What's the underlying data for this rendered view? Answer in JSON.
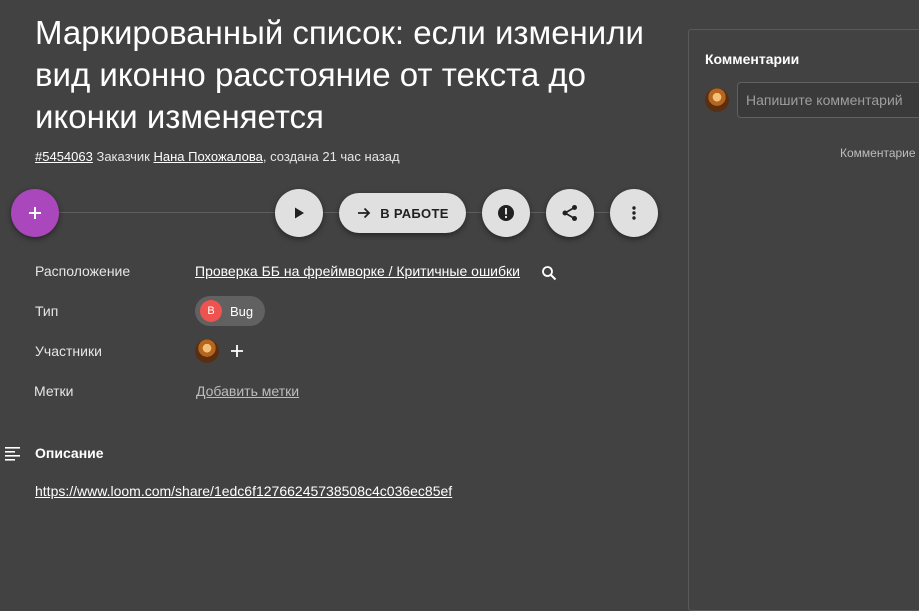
{
  "task": {
    "title": "Маркированный список: если изменили вид иконно расстояние от текста до иконки изменяется",
    "id": "#5454063",
    "customer_prefix": "Заказчик",
    "customer_name": "Нана Похожалова",
    "created": ", создана 21 час назад"
  },
  "actions": {
    "add_icon": "plus-icon",
    "play_icon": "play-icon",
    "status_label": "В РАБОТЕ",
    "status_icon": "arrow-right-icon",
    "priority_icon": "alert-icon",
    "share_icon": "share-icon",
    "more_icon": "more-vert-icon",
    "fab_color": "#ab47bc"
  },
  "fields": {
    "location_label": "Расположение",
    "location_value": "Проверка ББ на фреймворке / Критичные ошибки",
    "type_label": "Тип",
    "type_letter": "B",
    "type_value": "Bug",
    "type_color": "#ef5350",
    "participants_label": "Участники",
    "tags_label": "Метки",
    "tags_value": "Добавить метки"
  },
  "description": {
    "title": "Описание",
    "link": "https://www.loom.com/share/1edc6f12766245738508c4c036ec85ef"
  },
  "comments": {
    "title": "Комментарии",
    "placeholder": "Напишите комментарий",
    "note": "Комментарие"
  }
}
